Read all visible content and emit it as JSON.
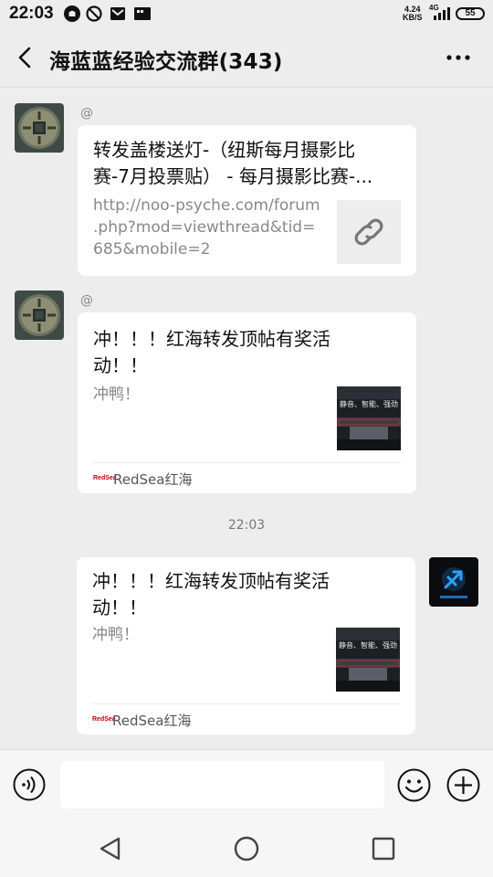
{
  "status_bar": {
    "time": "22:03",
    "net_speed_value": "4.24",
    "net_speed_unit": "KB/S",
    "network": "4G",
    "battery": "55",
    "icons": [
      "notification-icon",
      "do-not-disturb-icon",
      "mail-icon",
      "sd-card-icon",
      "signal-icon",
      "battery-icon"
    ]
  },
  "header": {
    "title": "海蓝蓝经验交流群(343)",
    "back_icon": "chevron-left-icon",
    "more_icon": "more-dots-icon"
  },
  "messages": [
    {
      "sender": "@",
      "avatar": "coin-avatar",
      "title": "转发盖楼送灯-（纽斯每月摄影比赛-7月投票贴） - 每月摄影比赛-...",
      "title_line1": "转发盖楼送灯-（纽斯每月摄影比",
      "title_line2": "赛-7月投票贴） - 每月摄影比赛-...",
      "url": "http://noo-psyche.com/forum.php?mod=viewthread&tid=685&mobile=2",
      "url_line1": "http://noo-psyche.com/forum",
      "url_line2": ".php?mod=viewthread&tid=",
      "url_line3": "685&mobile=2",
      "thumb_icon": "link-icon"
    },
    {
      "sender": "@",
      "avatar": "coin-avatar",
      "title_line1": "冲！！！红海转发顶帖有奖活",
      "title_line2": "动！！",
      "desc": "冲鸭！",
      "thumb_text": "静音、智能、强劲",
      "source_logo": "RedSea",
      "source": "RedSea红海"
    },
    {
      "sender": "self",
      "avatar": "sagittarius-avatar",
      "title_line1": "冲！！！红海转发顶帖有奖活",
      "title_line2": "动！！",
      "desc": "冲鸭！",
      "thumb_text": "静音、智能、强劲",
      "source_logo": "RedSea",
      "source": "RedSea红海"
    }
  ],
  "timestamp": "22:03",
  "input_bar": {
    "value": "",
    "voice_icon": "voice-icon",
    "emoji_icon": "emoji-icon",
    "plus_icon": "plus-icon"
  },
  "nav_bar": {
    "icons": [
      "back-triangle-icon",
      "home-circle-icon",
      "recents-square-icon"
    ]
  },
  "colors": {
    "background": "#ededed",
    "card": "#ffffff",
    "muted_text": "#888888",
    "brand_red": "#c40000"
  }
}
